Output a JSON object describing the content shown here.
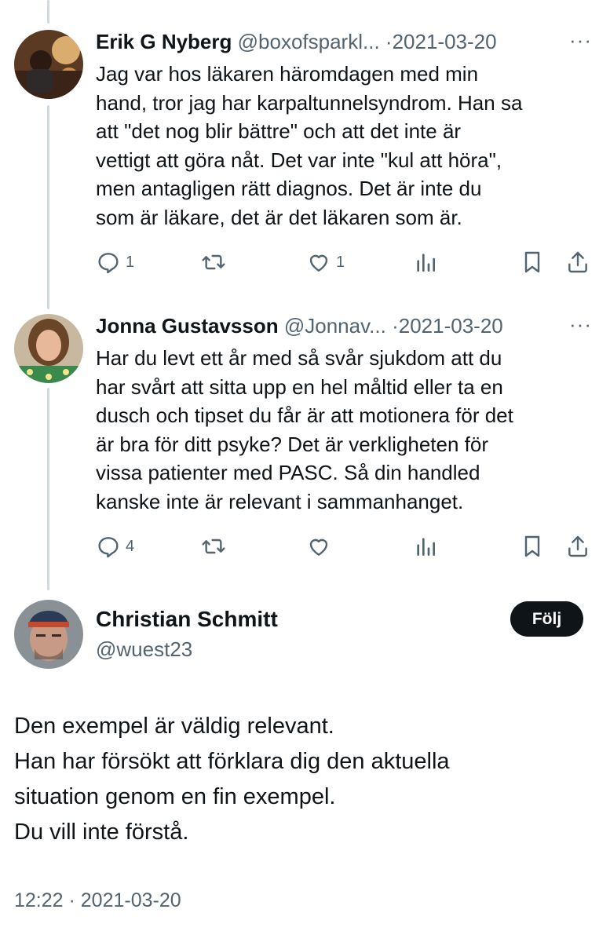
{
  "replies": [
    {
      "name": "Erik G Nyberg",
      "handle": "@boxofsparkl...",
      "date": "2021-03-20",
      "more": "···",
      "lines": [
        "Jag var hos läkaren häromdagen med min",
        "hand, tror jag har karpaltunnelsyndrom. Han sa",
        "att \"det nog blir bättre\" och att det inte är",
        "vettigt att göra nåt. Det var inte \"kul att höra\",",
        "men antagligen rätt diagnos. Det är inte du",
        "som är läkare, det är det läkaren som är."
      ],
      "reply_count": "1",
      "retweet_count": "",
      "like_count": "1"
    },
    {
      "name": "Jonna Gustavsson",
      "handle": "@Jonnav...",
      "date": "2021-03-20",
      "more": "···",
      "lines": [
        "Har du levt ett år med så svår sjukdom  att du",
        "har svårt att sitta upp en hel måltid eller ta en",
        "dusch och tipset du får är att motionera för det",
        "är bra för ditt psyke? Det är verkligheten för",
        "vissa patienter med PASC. Så din handled",
        "kanske inte är relevant i sammanhanget."
      ],
      "reply_count": "4",
      "retweet_count": "",
      "like_count": ""
    }
  ],
  "main": {
    "name": "Christian Schmitt",
    "handle": "@wuest23",
    "follow_label": "Följ",
    "lines": [
      "Den exempel är väldig relevant.",
      "Han har försökt att förklara dig den aktuella",
      "situation genom en fin exempel.",
      "Du vill inte förstå."
    ],
    "timestamp": "12:22 · 2021-03-20"
  },
  "colors": {
    "text": "#0f1419",
    "secondary": "#536471",
    "thread_line": "#cfd9de",
    "follow_bg": "#0f1419"
  },
  "icons": [
    "reply-icon",
    "retweet-icon",
    "like-icon",
    "views-icon",
    "bookmark-icon",
    "share-icon",
    "more-icon"
  ]
}
